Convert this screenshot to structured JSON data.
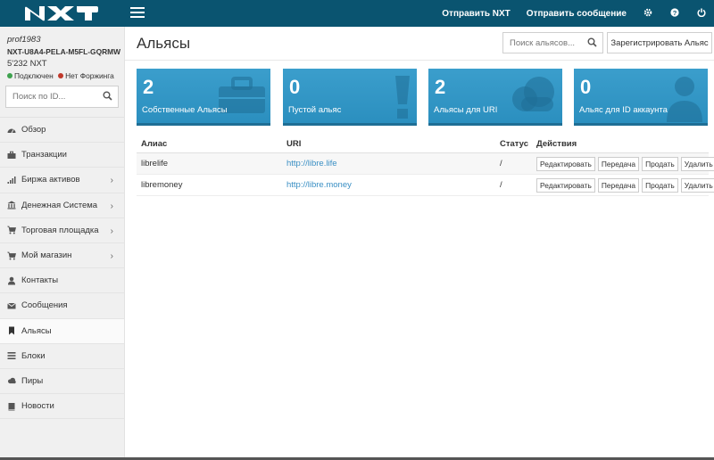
{
  "topbar": {
    "send_nxt": "Отправить NXT",
    "send_message": "Отправить сообщение",
    "icons": [
      "gear-icon",
      "question-icon",
      "power-icon"
    ]
  },
  "account": {
    "user": "prof1983",
    "id": "NXT-U8A4-PELA-M5FL-GQRMW",
    "balance": "5'232 NXT",
    "status_connected": "Подключен",
    "status_forging": "Нет Форжинга"
  },
  "sidebar": {
    "search_placeholder": "Поиск по ID...",
    "items": [
      {
        "label": "Обзор",
        "icon": "dashboard-icon"
      },
      {
        "label": "Транзакции",
        "icon": "briefcase-icon"
      },
      {
        "label": "Биржа активов",
        "icon": "signal-icon"
      },
      {
        "label": "Денежная Система",
        "icon": "bank-icon"
      },
      {
        "label": "Торговая площадка",
        "icon": "cart-icon"
      },
      {
        "label": "Мой магазин",
        "icon": "cart-icon"
      },
      {
        "label": "Контакты",
        "icon": "user-icon"
      },
      {
        "label": "Сообщения",
        "icon": "envelope-icon"
      },
      {
        "label": "Альясы",
        "icon": "bookmark-icon"
      },
      {
        "label": "Блоки",
        "icon": "list-icon"
      },
      {
        "label": "Пиры",
        "icon": "cloud-icon"
      },
      {
        "label": "Новости",
        "icon": "book-icon"
      }
    ]
  },
  "main": {
    "title": "Альясы",
    "search_placeholder": "Поиск альясов...",
    "register_button": "Зарегистрировать Альяс",
    "cards": [
      {
        "value": "2",
        "label": "Собственные Альясы",
        "icon": "briefcase-icon"
      },
      {
        "value": "0",
        "label": "Пустой альяс",
        "icon": "exclamation-icon"
      },
      {
        "value": "2",
        "label": "Альясы для URI",
        "icon": "cloud-icon"
      },
      {
        "value": "0",
        "label": "Альяс для ID аккаунта",
        "icon": "user-icon"
      }
    ],
    "table": {
      "headers": {
        "alias": "Алиас",
        "uri": "URI",
        "status": "Статус",
        "actions": "Действия"
      },
      "rows": [
        {
          "alias": "librelife",
          "uri": "http://libre.life",
          "status": "/",
          "actions": [
            "Редактировать",
            "Передача",
            "Продать",
            "Удалить"
          ]
        },
        {
          "alias": "libremoney",
          "uri": "http://libre.money",
          "status": "/",
          "actions": [
            "Редактировать",
            "Передача",
            "Продать",
            "Удалить"
          ]
        }
      ]
    }
  },
  "colors": {
    "topbar": "#0a5470",
    "card": "#2b8fbf",
    "link": "#3a8fc4"
  }
}
